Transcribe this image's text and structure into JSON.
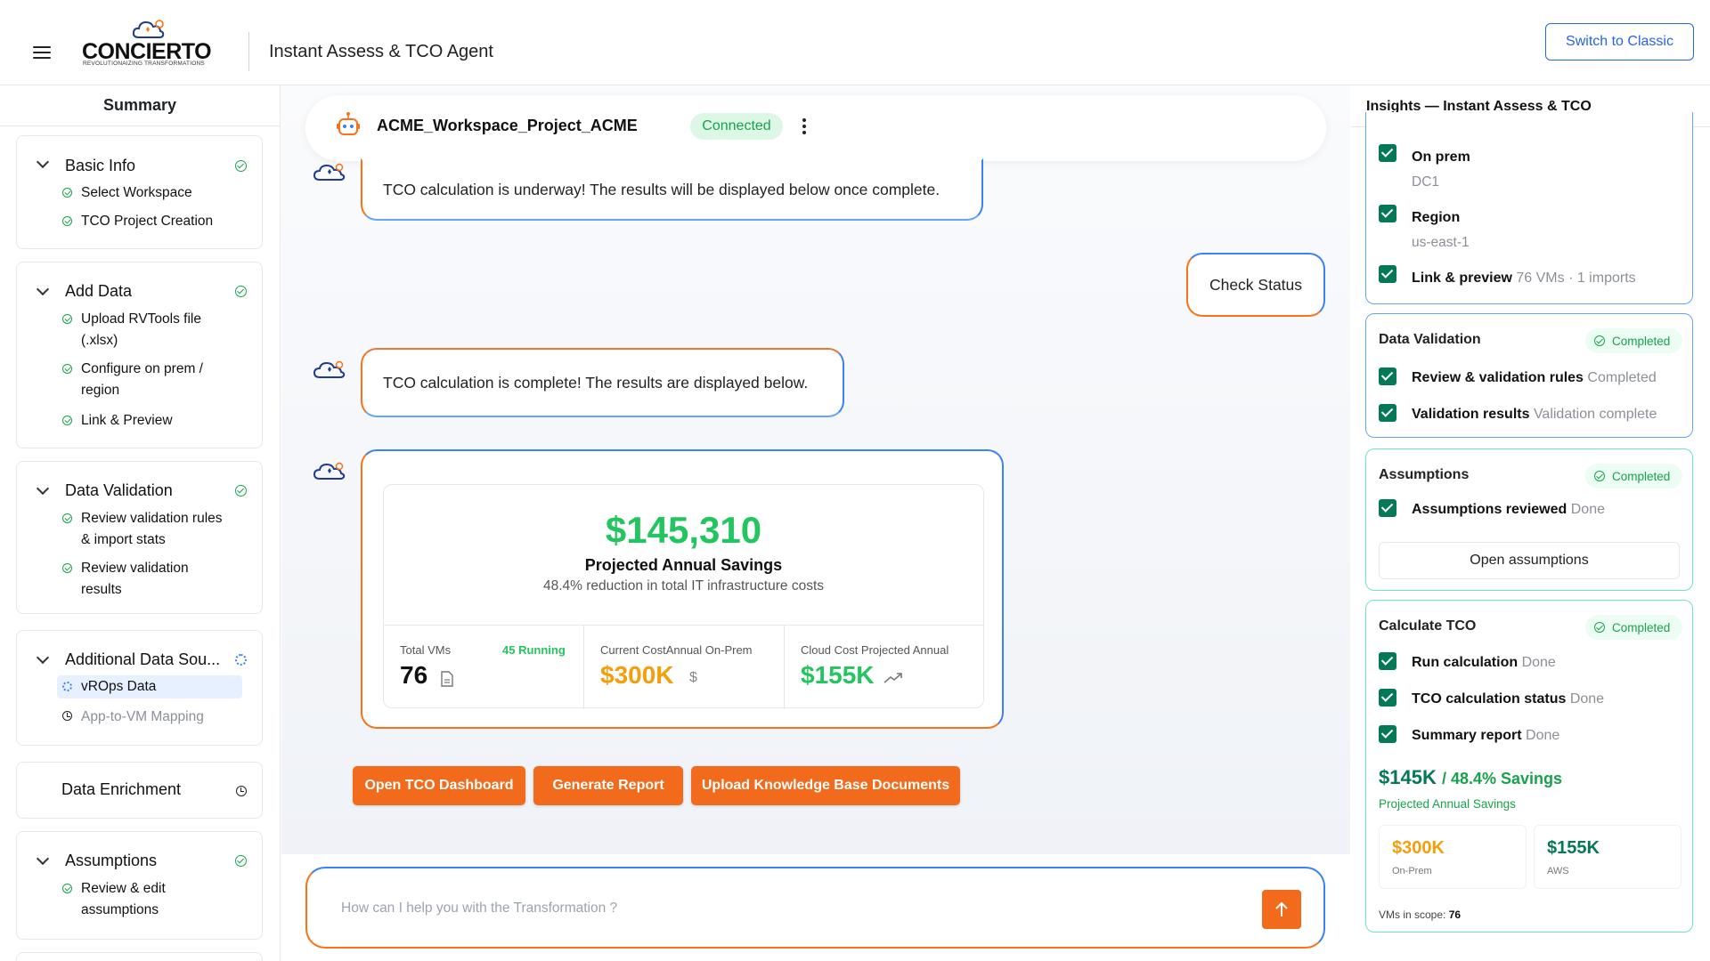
{
  "header": {
    "logo_name": "CONCIERTO",
    "logo_tagline": "REVOLUTIONAIZING TRANSFORMATIONS",
    "title": "Instant Assess & TCO Agent",
    "switch_label": "Switch to Classic"
  },
  "summary": {
    "title": "Summary",
    "sections": [
      {
        "title": "Basic Info",
        "items": [
          "Select Workspace",
          "TCO Project Creation"
        ]
      },
      {
        "title": "Add Data",
        "items": [
          "Upload RVTools file",
          "(.xlsx)",
          "Configure on prem /",
          "region",
          "Link & Preview"
        ]
      },
      {
        "title": "Data Validation",
        "items": [
          "Review validation rules",
          "& import stats",
          "Review validation",
          "results"
        ]
      },
      {
        "title": "Additional Data Sou...",
        "items": [
          "vROps Data",
          "App-to-VM Mapping"
        ]
      },
      {
        "title": "Data Enrichment",
        "items": []
      },
      {
        "title": "Assumptions",
        "items": [
          "Review & edit",
          "assumptions"
        ]
      }
    ]
  },
  "workspace": {
    "name": "ACME_Workspace_Project_ACME",
    "status": "Connected"
  },
  "chat": {
    "msg1": "TCO calculation is underway! The results will be displayed below once complete.",
    "user1": "Check Status",
    "msg2": "TCO calculation is complete! The results are displayed below.",
    "result": {
      "savings": "$145,310",
      "savings_label": "Projected Annual Savings",
      "reduction": "48.4% reduction in total IT infrastructure costs",
      "total_vms_label": "Total VMs",
      "running": "45 Running",
      "total_vms": "76",
      "current_label": "Current CostAnnual On-Prem",
      "current_value": "$300K",
      "current_unit": "$",
      "cloud_label": "Cloud Cost  Projected Annual",
      "cloud_value": "$155K"
    },
    "actions": [
      "Open TCO Dashboard",
      "Generate Report",
      "Upload Knowledge Base Documents"
    ],
    "input_placeholder": "How can I help you with the Transformation ?"
  },
  "insights": {
    "title": "Insights — Instant Assess & TCO",
    "top": {
      "on_prem": "On prem",
      "on_prem_val": "DC1",
      "region": "Region",
      "region_val": "us-east-1",
      "link": "Link & preview",
      "link_val": "76 VMs · 1 imports"
    },
    "validation": {
      "title": "Data Validation",
      "badge": "Completed",
      "i1": "Review & validation rules",
      "i1v": "Completed",
      "i2": "Validation results",
      "i2v": "Validation complete"
    },
    "assumptions": {
      "title": "Assumptions",
      "badge": "Completed",
      "i1": "Assumptions reviewed",
      "i1v": "Done",
      "button": "Open assumptions"
    },
    "tco": {
      "title": "Calculate TCO",
      "badge": "Completed",
      "i1": "Run calculation",
      "i1v": "Done",
      "i2": "TCO calculation status",
      "i2v": "Done",
      "i3": "Summary report",
      "i3v": "Done",
      "save_main": "$145K",
      "save_pct": "/ 48.4% Savings",
      "save_label": "Projected Annual Savings",
      "onprem_val": "$300K",
      "onprem_lbl": "On-Prem",
      "aws_val": "$155K",
      "aws_lbl": "AWS",
      "vms_label": "VMs in scope:",
      "vms_val": "76"
    }
  },
  "colors": {
    "accent": "#f26b1d",
    "blue": "#2563eb",
    "green": "#22c55e",
    "dark_green": "#047857"
  }
}
